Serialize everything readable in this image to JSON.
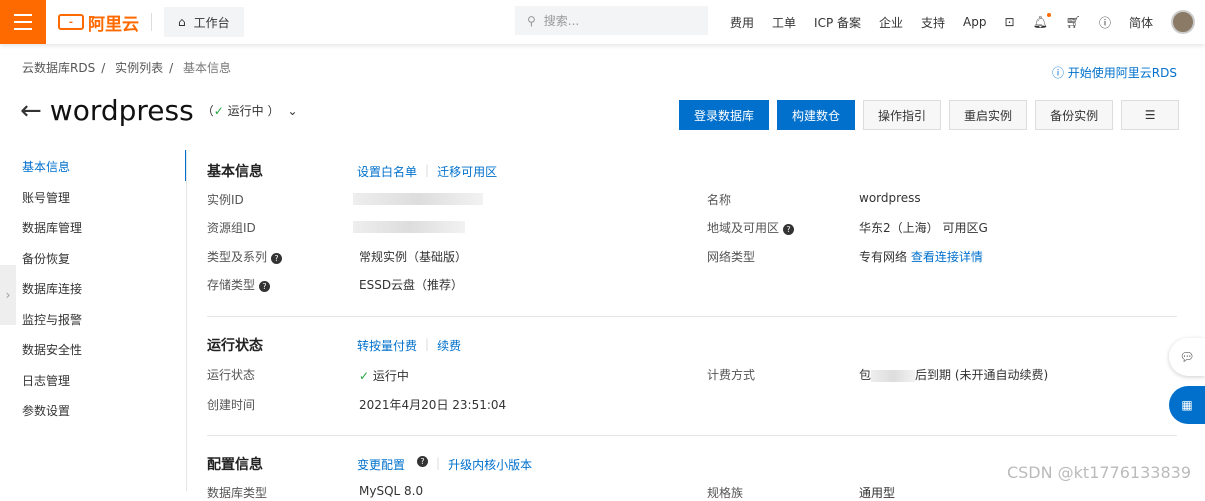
{
  "header": {
    "logo": "阿里云",
    "workbench": "工作台",
    "search_placeholder": "搜索...",
    "nav": [
      "费用",
      "工单",
      "ICP 备案",
      "企业",
      "支持",
      "App"
    ],
    "lang": "简体"
  },
  "breadcrumb": [
    "云数据库RDS",
    "实例列表",
    "基本信息"
  ],
  "help_link": "开始使用阿里云RDS",
  "instance": {
    "name": "wordpress",
    "status": "运行中"
  },
  "buttons": [
    "登录数据库",
    "构建数仓",
    "操作指引",
    "重启实例",
    "备份实例"
  ],
  "sidebar": [
    "基本信息",
    "账号管理",
    "数据库管理",
    "备份恢复",
    "数据库连接",
    "监控与报警",
    "数据安全性",
    "日志管理",
    "参数设置"
  ],
  "basic": {
    "title": "基本信息",
    "links": [
      "设置白名单",
      "迁移可用区"
    ],
    "instance_id_label": "实例ID",
    "resource_group_label": "资源组ID",
    "type_label": "类型及系列",
    "type_value": "常规实例（基础版）",
    "storage_label": "存储类型",
    "storage_value": "ESSD云盘（推荐）",
    "name_label": "名称",
    "name_value": "wordpress",
    "region_label": "地域及可用区",
    "region_value": "华东2（上海） 可用区G",
    "network_label": "网络类型",
    "network_value": "专有网络",
    "network_link": "查看连接详情"
  },
  "run": {
    "title": "运行状态",
    "links": [
      "转按量付费",
      "续费"
    ],
    "status_label": "运行状态",
    "status_value": "运行中",
    "created_label": "创建时间",
    "created_value": "2021年4月20日 23:51:04",
    "billing_label": "计费方式",
    "billing_prefix": "包",
    "billing_suffix": "后到期 (未开通自动续费)"
  },
  "config": {
    "title": "配置信息",
    "links": [
      "变更配置",
      "升级内核小版本"
    ],
    "db_type_label": "数据库类型",
    "db_type_value": "MySQL 8.0",
    "spec_label": "规格族",
    "spec_value": "通用型"
  },
  "watermark": "CSDN @kt1776133839"
}
